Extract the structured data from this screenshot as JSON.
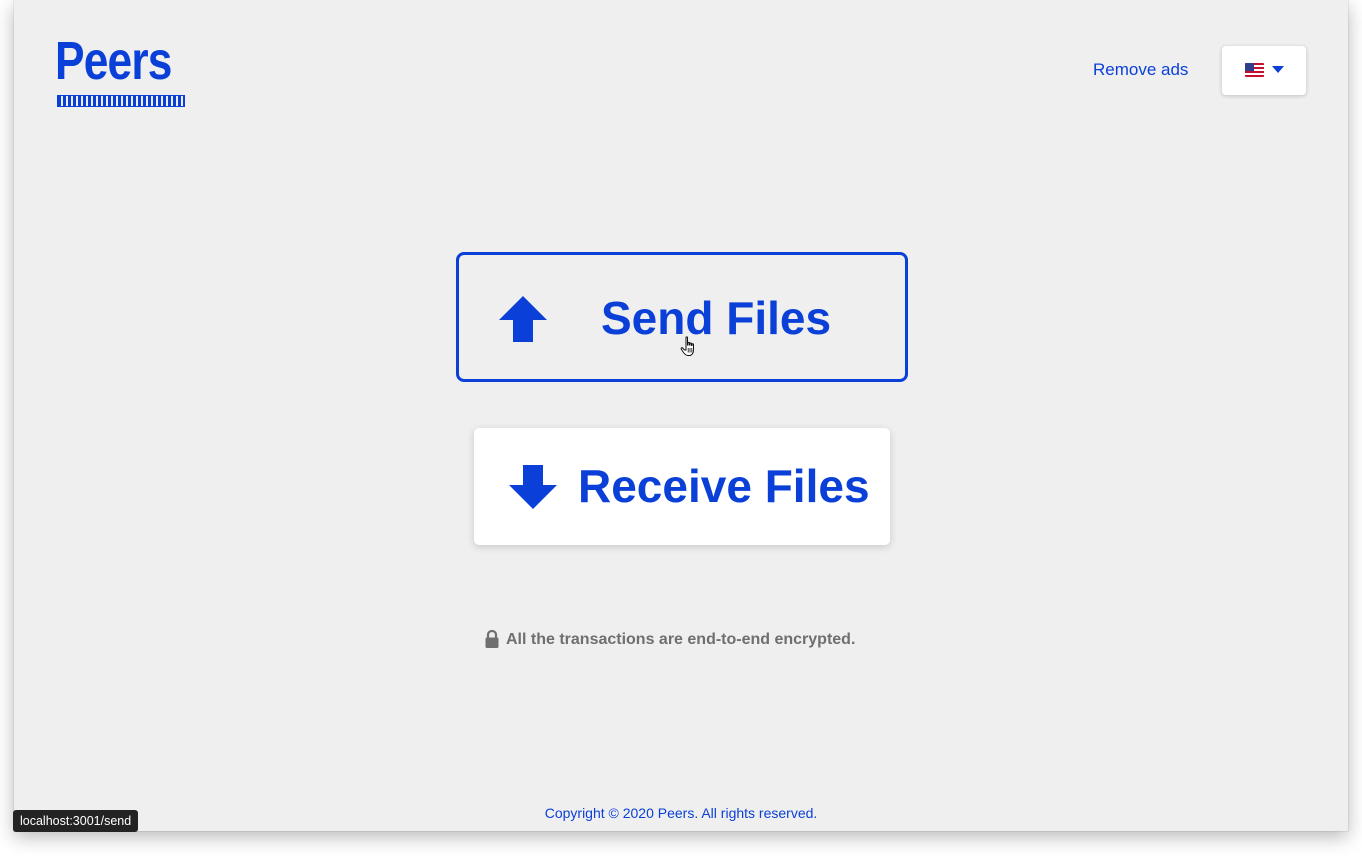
{
  "brand": {
    "logo_text": "Peers"
  },
  "header": {
    "remove_ads_label": "Remove ads",
    "language_flag": "us-flag-icon"
  },
  "actions": {
    "send_label": "Send Files",
    "receive_label": "Receive Files"
  },
  "security_note": "All the transactions are end-to-end encrypted.",
  "footer": {
    "copyright": "Copyright © 2020 Peers. All rights reserved."
  },
  "status_bar": {
    "url": "localhost:3001/send"
  },
  "colors": {
    "accent": "#0a3fd8",
    "background": "#efefef",
    "muted_text": "#6f6f6f"
  }
}
